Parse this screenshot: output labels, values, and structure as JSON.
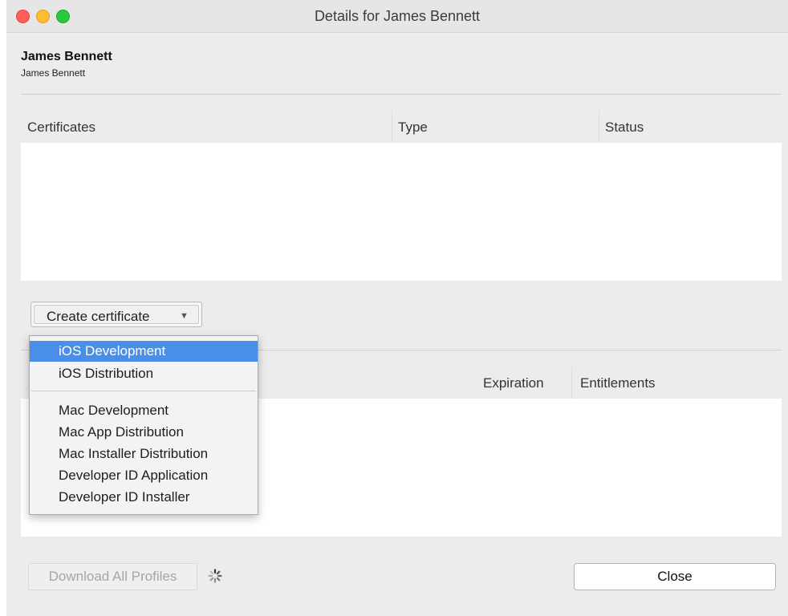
{
  "window": {
    "title": "Details for James Bennett"
  },
  "user": {
    "name": "James Bennett",
    "subtitle": "James Bennett"
  },
  "certificates_table": {
    "columns": [
      "Certificates",
      "Type",
      "Status"
    ],
    "rows": []
  },
  "create_certificate": {
    "label": "Create certificate",
    "caret": "▼",
    "menu": {
      "selected": "iOS Development",
      "items": [
        "iOS Development",
        "iOS Distribution",
        "Mac Development",
        "Mac App Distribution",
        "Mac Installer Distribution",
        "Developer ID Application",
        "Developer ID Installer"
      ]
    }
  },
  "profiles_table": {
    "columns": [
      "Expiration",
      "Entitlements"
    ],
    "rows": []
  },
  "footer": {
    "download_label": "Download All Profiles",
    "close_label": "Close"
  },
  "colors": {
    "selection": "#4a8fe7",
    "traffic_red": "#fd5f57",
    "traffic_yellow": "#febc2e",
    "traffic_green": "#28c840"
  }
}
